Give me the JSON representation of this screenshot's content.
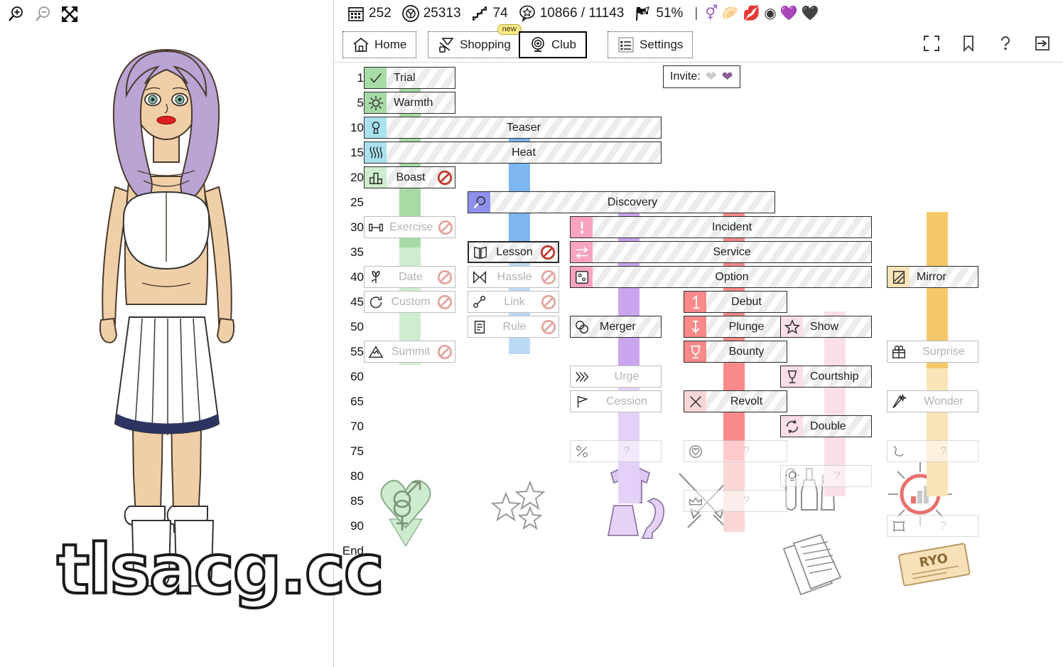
{
  "left_panel": {
    "zoom_in_icon": "magnifier-plus-icon",
    "zoom_out_icon": "magnifier-minus-icon",
    "fullscreen_icon": "expand-arrows-icon",
    "avatar_alt": "character-portrait"
  },
  "status_bar": {
    "items": [
      {
        "icon": "calendar-icon",
        "value": "252"
      },
      {
        "icon": "target-icon",
        "value": "25313"
      },
      {
        "icon": "stairs-icon",
        "value": "74"
      },
      {
        "icon": "star-bubble-icon",
        "value": "10866 / 11143"
      },
      {
        "icon": "checkered-flag-icon",
        "value": "51%"
      }
    ],
    "divider": "|",
    "badges": [
      {
        "icon": "venus-mars-icon",
        "glyph": "⚥"
      },
      {
        "icon": "breasts-icon",
        "glyph": "🥟"
      },
      {
        "icon": "lipstick-kiss-icon",
        "glyph": "💋"
      },
      {
        "icon": "camera-lens-icon",
        "glyph": "◉"
      },
      {
        "icon": "purple-heart-icon",
        "glyph": "💜"
      },
      {
        "icon": "black-heart-icon",
        "glyph": "🖤"
      }
    ]
  },
  "toolbar": {
    "nav": [
      {
        "label": "Home",
        "icon": "house-icon",
        "badge": "",
        "active": false
      },
      {
        "label": "Shopping",
        "icon": "shopping-icon",
        "badge": "new",
        "active": false
      },
      {
        "label": "Club",
        "icon": "webcam-icon",
        "badge": "",
        "active": true
      },
      {
        "label": "Settings",
        "icon": "checklist-icon",
        "badge": "",
        "active": false
      }
    ],
    "right_icons": [
      {
        "icon": "fullscreen-icon"
      },
      {
        "icon": "bookmark-icon"
      },
      {
        "icon": "help-icon"
      },
      {
        "icon": "logout-icon"
      }
    ]
  },
  "invite": {
    "label": "Invite:",
    "hearts": [
      {
        "icon": "grey-heart-icon",
        "color": "#c9c9c9"
      },
      {
        "icon": "purple-heart-icon",
        "color": "#8a5b94"
      }
    ]
  },
  "tree": {
    "tier_labels": [
      "1",
      "5",
      "10",
      "15",
      "20",
      "25",
      "30",
      "35",
      "40",
      "45",
      "50",
      "55",
      "60",
      "65",
      "70",
      "75",
      "80",
      "85",
      "90",
      "End"
    ],
    "colors": {
      "green": "#a6dba6",
      "green_pale": "#cfeccf",
      "cyan": "#a9e2ef",
      "blue": "#7eb6ef",
      "blue_pale": "#bcd9f5",
      "periwinkle": "#8f90ee",
      "pink": "#f9a3c0",
      "purple": "#c9a6ee",
      "purple_pale": "#e3d1f7",
      "red": "#f98a8a",
      "red_pale": "#fbd6d6",
      "pink_pale": "#fadfe6",
      "orange": "#f5c96b",
      "orange_pale": "#fae4b8"
    },
    "nodes": [
      {
        "name": "trial",
        "label": "Trial",
        "icon": "checkmark-icon",
        "tier": "1",
        "col": 0,
        "span": 1,
        "state": "unlocked",
        "accent": "green",
        "locked_badge": false
      },
      {
        "name": "warmth",
        "label": "Warmth",
        "icon": "sun-icon",
        "tier": "5",
        "col": 0,
        "span": 1,
        "state": "unlocked",
        "accent": "green",
        "locked_badge": false
      },
      {
        "name": "teaser",
        "label": "Teaser",
        "icon": "keyhole-icon",
        "tier": "10",
        "col": 0,
        "span": 3,
        "state": "unlocked",
        "accent": "cyan",
        "locked_badge": false
      },
      {
        "name": "heat",
        "label": "Heat",
        "icon": "heatwave-icon",
        "tier": "15",
        "col": 0,
        "span": 3,
        "state": "unlocked",
        "accent": "cyan",
        "locked_badge": false
      },
      {
        "name": "boast",
        "label": "Boast",
        "icon": "bar-chart-icon",
        "tier": "20",
        "col": 0,
        "span": 1,
        "state": "available",
        "accent": "green_pale",
        "locked_badge": true
      },
      {
        "name": "discovery",
        "label": "Discovery",
        "icon": "magnifier-icon",
        "tier": "25",
        "col": 1,
        "span": 3,
        "state": "unlocked",
        "accent": "periwinkle",
        "locked_badge": false
      },
      {
        "name": "incident",
        "label": "Incident",
        "icon": "exclamation-icon",
        "tier": "30",
        "col": 2,
        "span": 3,
        "state": "unlocked",
        "accent": "pink",
        "locked_badge": false
      },
      {
        "name": "exercise",
        "label": "Exercise",
        "icon": "dumbbell-icon",
        "tier": "30",
        "col": 0,
        "span": 1,
        "state": "locked",
        "accent": "none",
        "locked_badge": true
      },
      {
        "name": "lesson",
        "label": "Lesson",
        "icon": "book-icon",
        "tier": "35",
        "col": 1,
        "span": 1,
        "state": "available",
        "accent": "white",
        "locked_badge": true
      },
      {
        "name": "service",
        "label": "Service",
        "icon": "exchange-icon",
        "tier": "35",
        "col": 2,
        "span": 3,
        "state": "unlocked",
        "accent": "pink",
        "locked_badge": false
      },
      {
        "name": "date",
        "label": "Date",
        "icon": "flower-icon",
        "tier": "40",
        "col": 0,
        "span": 1,
        "state": "locked",
        "accent": "none",
        "locked_badge": true
      },
      {
        "name": "hassle",
        "label": "Hassle",
        "icon": "hourglass-icon",
        "tier": "40",
        "col": 1,
        "span": 1,
        "state": "locked",
        "accent": "none",
        "locked_badge": true
      },
      {
        "name": "option",
        "label": "Option",
        "icon": "dice-icon",
        "tier": "40",
        "col": 2,
        "span": 3,
        "state": "unlocked",
        "accent": "pink",
        "locked_badge": false
      },
      {
        "name": "custom",
        "label": "Custom",
        "icon": "refresh-icon",
        "tier": "45",
        "col": 0,
        "span": 1,
        "state": "locked",
        "accent": "none",
        "locked_badge": true
      },
      {
        "name": "link",
        "label": "Link",
        "icon": "link-node-icon",
        "tier": "45",
        "col": 1,
        "span": 1,
        "state": "locked",
        "accent": "none",
        "locked_badge": true
      },
      {
        "name": "debut",
        "label": "Debut",
        "icon": "number-one-icon",
        "tier": "45",
        "col": 3,
        "span": 2,
        "state": "unlocked",
        "accent": "red",
        "locked_badge": false
      },
      {
        "name": "rule",
        "label": "Rule",
        "icon": "scroll-icon",
        "tier": "50",
        "col": 1,
        "span": 1,
        "state": "locked",
        "accent": "none",
        "locked_badge": true
      },
      {
        "name": "merger",
        "label": "Merger",
        "icon": "venn-icon",
        "tier": "50",
        "col": 2,
        "span": 1,
        "state": "unlocked",
        "accent": "white",
        "locked_badge": false
      },
      {
        "name": "plunge",
        "label": "Plunge",
        "icon": "down-arrow-icon",
        "tier": "50",
        "col": 3,
        "span": 2,
        "state": "unlocked",
        "accent": "red",
        "locked_badge": false
      },
      {
        "name": "show",
        "label": "Show",
        "icon": "star-icon",
        "tier": "50",
        "col": 4,
        "span": 1,
        "state": "unlocked",
        "accent": "pink_pale",
        "locked_badge": false
      },
      {
        "name": "summit",
        "label": "Summit",
        "icon": "mountain-icon",
        "tier": "55",
        "col": 0,
        "span": 1,
        "state": "locked",
        "accent": "none",
        "locked_badge": true
      },
      {
        "name": "bounty",
        "label": "Bounty",
        "icon": "trophy-icon",
        "tier": "55",
        "col": 3,
        "span": 2,
        "state": "unlocked",
        "accent": "red",
        "locked_badge": false
      },
      {
        "name": "surprise",
        "label": "Surprise",
        "icon": "gift-icon",
        "tier": "55",
        "col": 5,
        "span": 1,
        "state": "locked",
        "accent": "none",
        "locked_badge": false
      },
      {
        "name": "mirror",
        "label": "Mirror",
        "icon": "mirror-icon",
        "tier": "40",
        "col": 5,
        "span": 1,
        "state": "unlocked",
        "accent": "orange_pale",
        "locked_badge": false
      },
      {
        "name": "urge",
        "label": "Urge",
        "icon": "chevrons-icon",
        "tier": "60",
        "col": 2,
        "span": 1,
        "state": "locked",
        "accent": "none",
        "locked_badge": false
      },
      {
        "name": "courtship",
        "label": "Courtship",
        "icon": "wine-glass-icon",
        "tier": "60",
        "col": 4,
        "span": 1,
        "state": "unlocked",
        "accent": "pink_pale",
        "locked_badge": false
      },
      {
        "name": "cession",
        "label": "Cession",
        "icon": "flag-icon",
        "tier": "65",
        "col": 2,
        "span": 1,
        "state": "locked",
        "accent": "none",
        "locked_badge": false
      },
      {
        "name": "revolt",
        "label": "Revolt",
        "icon": "cross-swords-icon",
        "tier": "65",
        "col": 3,
        "span": 2,
        "state": "unlocked",
        "accent": "red_pale",
        "locked_badge": false
      },
      {
        "name": "wonder",
        "label": "Wonder",
        "icon": "magic-wand-icon",
        "tier": "65",
        "col": 5,
        "span": 1,
        "state": "locked",
        "accent": "none",
        "locked_badge": false
      },
      {
        "name": "double",
        "label": "Double",
        "icon": "recycle-icon",
        "tier": "70",
        "col": 4,
        "span": 1,
        "state": "unlocked",
        "accent": "pink_pale",
        "locked_badge": false
      },
      {
        "name": "unknown-1",
        "label": "?",
        "icon": "percent-icon",
        "tier": "75",
        "col": 2,
        "span": 1,
        "state": "hidden",
        "accent": "none",
        "locked_badge": false
      },
      {
        "name": "unknown-2",
        "label": "?",
        "icon": "heart-outline-icon",
        "tier": "75",
        "col": 3,
        "span": 2,
        "state": "hidden",
        "accent": "none",
        "locked_badge": false
      },
      {
        "name": "unknown-3",
        "label": "?",
        "icon": "zigzag-icon",
        "tier": "75",
        "col": 5,
        "span": 1,
        "state": "hidden",
        "accent": "none",
        "locked_badge": false
      },
      {
        "name": "unknown-4",
        "label": "?",
        "icon": "bulb-icon",
        "tier": "80",
        "col": 4,
        "span": 1,
        "state": "hidden",
        "accent": "none",
        "locked_badge": false
      },
      {
        "name": "unknown-5",
        "label": "?",
        "icon": "crown-icon",
        "tier": "85",
        "col": 3,
        "span": 2,
        "state": "hidden",
        "accent": "none",
        "locked_badge": false
      },
      {
        "name": "unknown-6",
        "label": "?",
        "icon": "pillow-icon",
        "tier": "90",
        "col": 5,
        "span": 1,
        "state": "hidden",
        "accent": "none",
        "locked_badge": false
      }
    ]
  },
  "footer_icons": [
    {
      "name": "gender-heart-icon"
    },
    {
      "name": "three-stars-icon"
    },
    {
      "name": "outfit-icon"
    },
    {
      "name": "crossed-swords-icon"
    },
    {
      "name": "cosmetics-icon"
    },
    {
      "name": "documents-icon"
    },
    {
      "name": "stats-sun-icon"
    },
    {
      "name": "ryo-ticket-icon"
    }
  ],
  "watermark": {
    "text": "tlsacg.cc"
  }
}
